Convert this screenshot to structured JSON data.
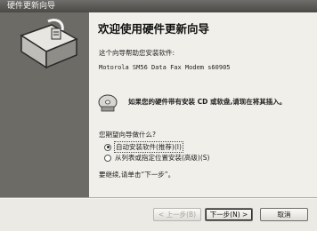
{
  "window": {
    "title": "硬件更新向导"
  },
  "main": {
    "heading": "欢迎使用硬件更新向导",
    "intro": "这个向导帮助您安装软件:",
    "device_name": "Motorola SM56 Data Fax Modem s60905",
    "cd_prompt": "如果您的硬件带有安装 CD 或软盘,请现在将其插入。",
    "question": "您期望向导做什么?",
    "options": [
      {
        "label": "自动安装软件(推荐)(I)",
        "selected": true
      },
      {
        "label": "从列表或指定位置安装(高级)(S)",
        "selected": false
      }
    ],
    "continue_hint": "要继续,请单击“下一步”。"
  },
  "buttons": {
    "back": "< 上一步(B)",
    "next": "下一步(N) >",
    "cancel": "取消"
  },
  "colors": {
    "title_bar": "#5a5955",
    "left_panel": "#6d6b66",
    "content_bg": "#f1efe9"
  },
  "icons": {
    "wizard_art": "hardware-box-icon",
    "cd": "cd-disc-icon"
  }
}
